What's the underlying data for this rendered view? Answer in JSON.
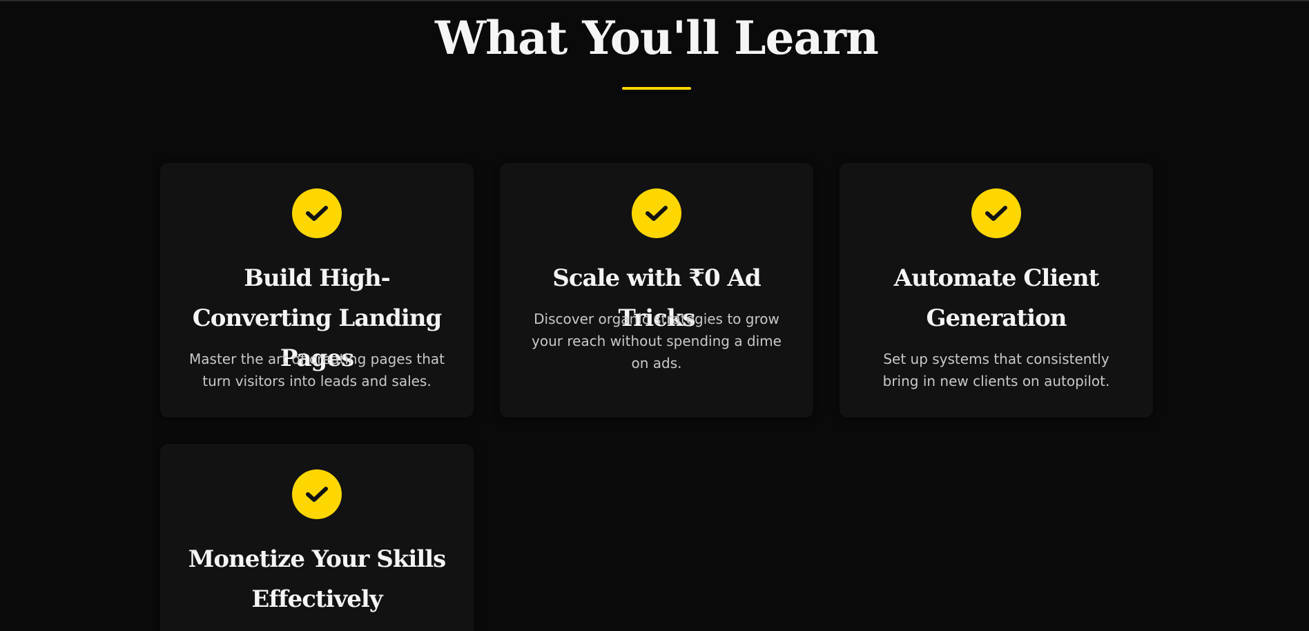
{
  "section": {
    "title": "What You'll Learn"
  },
  "colors": {
    "background": "#0a0a0a",
    "card": "#121212",
    "accent": "#ffd700",
    "title_text": "#f5f5f5",
    "body_text": "#c9c9c9"
  },
  "cards": [
    {
      "icon": "check-circle-icon",
      "title": "Build High-Converting Landing Pages",
      "description": "Master the art of creating pages that turn visitors into leads and sales."
    },
    {
      "icon": "check-circle-icon",
      "title": "Scale with ₹0 Ad Tricks",
      "description": "Discover organic strategies to grow your reach without spending a dime on ads."
    },
    {
      "icon": "check-circle-icon",
      "title": "Automate Client Generation",
      "description": "Set up systems that consistently bring in new clients on autopilot."
    },
    {
      "icon": "check-circle-icon",
      "title": "Monetize Your Skills Effectively",
      "description": ""
    }
  ]
}
